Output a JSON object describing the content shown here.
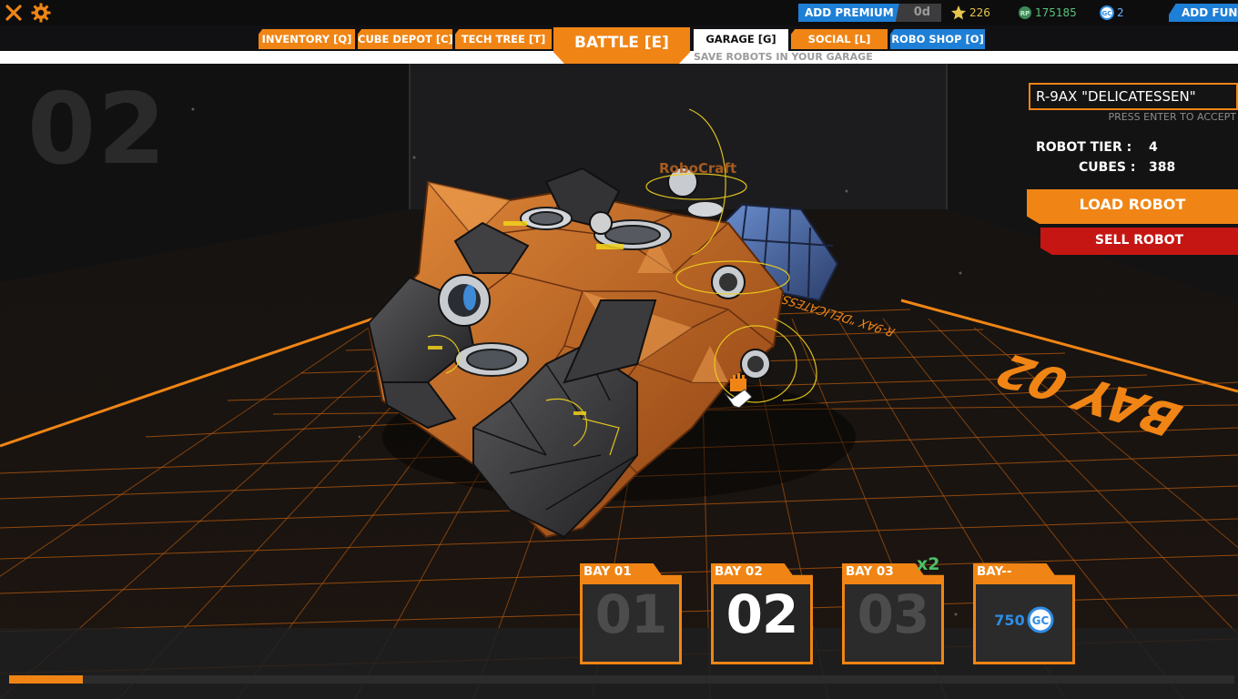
{
  "topbar": {
    "premium_label": "ADD PREMIUM",
    "premium_days": "0d",
    "stars": "226",
    "robits": "175185",
    "galaxy_coins": "2",
    "add_funds_label": "ADD FUNDS"
  },
  "tabs": {
    "inventory": "INVENTORY [Q]",
    "cube_depot": "CUBE DEPOT [C]",
    "tech_tree": "TECH TREE [T]",
    "battle": "BATTLE [E]",
    "garage": "GARAGE [G]",
    "social": "SOCIAL [L]",
    "robo_shop": "ROBO SHOP [O]",
    "active": "garage",
    "garage_hint": "SAVE ROBOTS IN YOUR GARAGE"
  },
  "scene": {
    "bay_watermark": "02",
    "floor_text": "BAY 02",
    "floor_subtext": "R-9AX \"DELICATESSEN\"",
    "robocraft_decal": "RoboCraft"
  },
  "robot_panel": {
    "name": "R-9AX \"DELICATESSEN\"",
    "enter_hint": "PRESS ENTER TO ACCEPT",
    "tier_label": "ROBOT TIER :",
    "tier_value": "4",
    "cubes_label": "CUBES :",
    "cubes_value": "388",
    "load_label": "LOAD ROBOT",
    "sell_label": "SELL ROBOT"
  },
  "bays": {
    "bay1": {
      "label": "BAY 01",
      "number": "01"
    },
    "bay2": {
      "label": "BAY 02",
      "number": "02",
      "selected": true
    },
    "bay3": {
      "label": "BAY 03",
      "number": "03",
      "multiplier": "x2"
    },
    "bay_buy": {
      "label": "BAY--",
      "price": "750",
      "currency_icon": "gc-coin-icon"
    }
  },
  "progress": {
    "value": 0.06
  },
  "colors": {
    "accent_orange": "#f08515",
    "premium_blue": "#1e7fd6",
    "sell_red": "#c51613",
    "robits_green": "#59c07a",
    "grid_orange": "#f08515"
  }
}
